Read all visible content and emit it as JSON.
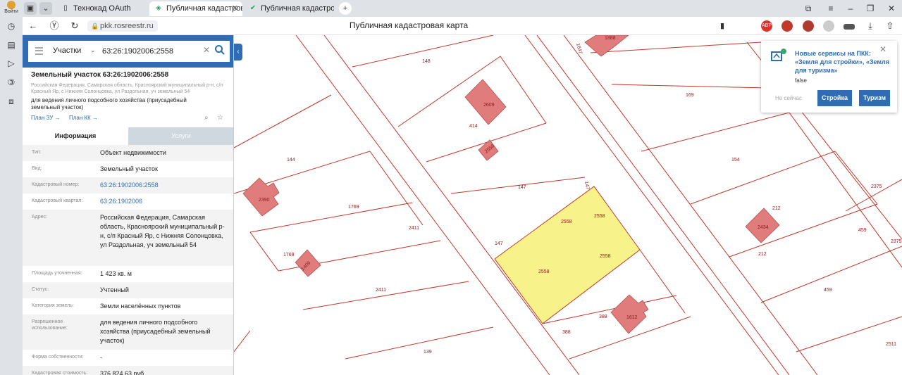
{
  "browser": {
    "profile_label": "Войти",
    "tabs": [
      {
        "label": "Технокад OAuth",
        "icon": "document-icon",
        "active": false
      },
      {
        "label": "Публичная кадастровая",
        "icon": "rosreestr-icon",
        "active": true
      },
      {
        "label": "Публичная кадастровая",
        "icon": "check-circle-icon",
        "active": false
      }
    ],
    "new_tab": "+",
    "url": "pkk.rosreestr.ru",
    "page_title": "Публичная кадастровая карта",
    "ext_abp": "ABP"
  },
  "search": {
    "type_label": "Участки",
    "query": "63:26:1902006:2558",
    "clear": "✕",
    "collapse": "‹"
  },
  "parcel": {
    "title": "Земельный участок 63:26:1902006:2558",
    "address_small": "Российская Федерация, Самарская область, Красноярский муниципальный р-н, с/п Красный Яр, с Нижняя Солонцовка, ул Раздольная, уч земельный 54",
    "use": "для ведения личного подсобного хозяйства (приусадебный земельный участок)",
    "link_zu": "План ЗУ →",
    "link_kk": "План КК →",
    "tab_info": "Информация",
    "tab_services": "Услуги",
    "rows": [
      {
        "k": "Тип:",
        "v": "Объект недвижимости",
        "link": false
      },
      {
        "k": "Вид:",
        "v": "Земельный участок",
        "link": false
      },
      {
        "k": "Кадастровый номер:",
        "v": "63:26:1902006:2558",
        "link": true
      },
      {
        "k": "Кадастровый квартал:",
        "v": "63:26:1902006",
        "link": true
      },
      {
        "k": "Адрес:",
        "v": "Российская Федерация, Самарская область, Красноярский муниципальный р-н, с/п Красный Яр, с Нижняя Солонцовка, ул Раздольная, уч земельный 54",
        "link": false
      },
      {
        "k": "Площадь уточненная:",
        "v": "1 423 кв. м",
        "link": false
      },
      {
        "k": "Статус:",
        "v": "Учтенный",
        "link": false
      },
      {
        "k": "Категория земель:",
        "v": "Земли населённых пунктов",
        "link": false
      },
      {
        "k": "Разрешенное использование:",
        "v": "для ведения личного подсобного хозяйства (приусадебный земельный участок)",
        "link": false
      },
      {
        "k": "Форма собственности:",
        "v": "-",
        "link": false
      },
      {
        "k": "Кадастровая стоимость:",
        "v": "376 824,63 руб.",
        "link": false
      }
    ]
  },
  "popup": {
    "text": "Новые сервисы на ПКК: «Земля для стройки», «Земля для туризма»",
    "flag": "false",
    "later": "Не сейчас",
    "btn1": "Стройка",
    "btn2": "Туризм",
    "close": "✕"
  },
  "map": {
    "labels": [
      "148",
      "1888",
      "1647",
      "169",
      "2609",
      "414",
      "2556",
      "144",
      "147",
      "147",
      "154",
      "2375",
      "1769",
      "2411",
      "2558",
      "2558",
      "2558",
      "2558",
      "212",
      "2434",
      "212",
      "459",
      "2375",
      "1769",
      "1409",
      "147",
      "2411",
      "388",
      "388",
      "1612",
      "459",
      "139",
      "2511",
      "2390"
    ]
  },
  "colors": {
    "accent": "#2f6cb3",
    "selected_parcel": "#f7f38a",
    "building": "#e07c7c",
    "parcel_line": "#c0392b"
  }
}
